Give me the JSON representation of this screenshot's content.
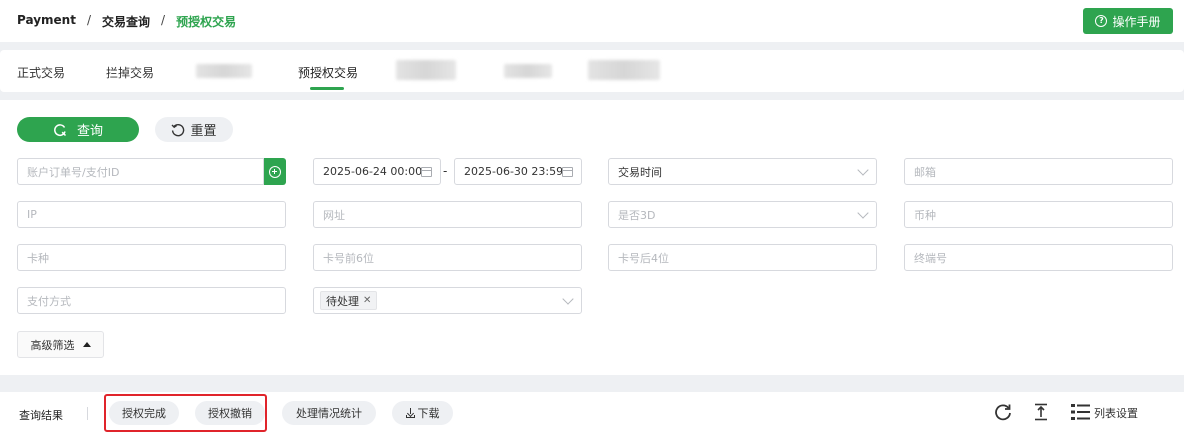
{
  "breadcrumb": {
    "root": "Payment",
    "level2": "交易查询",
    "current": "预授权交易",
    "separator": "/"
  },
  "header": {
    "manual_button": "操作手册",
    "manual_icon": "question-circle-icon"
  },
  "tabs": [
    {
      "label": "正式交易",
      "active": false
    },
    {
      "label": "拦掉交易",
      "active": false
    },
    {
      "label": "预授权交易",
      "active": true
    }
  ],
  "toolbar": {
    "search_label": "查询",
    "reset_label": "重置"
  },
  "filters": {
    "order_id_placeholder": "账户订单号/支付ID",
    "date_start": "2025-06-24 00:00",
    "date_end": "2025-06-30 23:59",
    "date_separator": "-",
    "time_type_value": "交易时间",
    "email_placeholder": "邮箱",
    "ip_placeholder": "IP",
    "url_placeholder": "网址",
    "is3d_placeholder": "是否3D",
    "currency_placeholder": "币种",
    "card_type_placeholder": "卡种",
    "card_first6_placeholder": "卡号前6位",
    "card_last4_placeholder": "卡号后4位",
    "terminal_placeholder": "终端号",
    "payment_method_placeholder": "支付方式",
    "status_tag": "待处理",
    "advanced_label": "高级筛选"
  },
  "results": {
    "label": "查询结果",
    "auth_complete": "授权完成",
    "auth_cancel": "授权撤销",
    "stats": "处理情况统计",
    "download": "下载",
    "list_settings": "列表设置"
  },
  "colors": {
    "brand_green": "#2ea44f",
    "highlight_red": "#e0242b"
  }
}
